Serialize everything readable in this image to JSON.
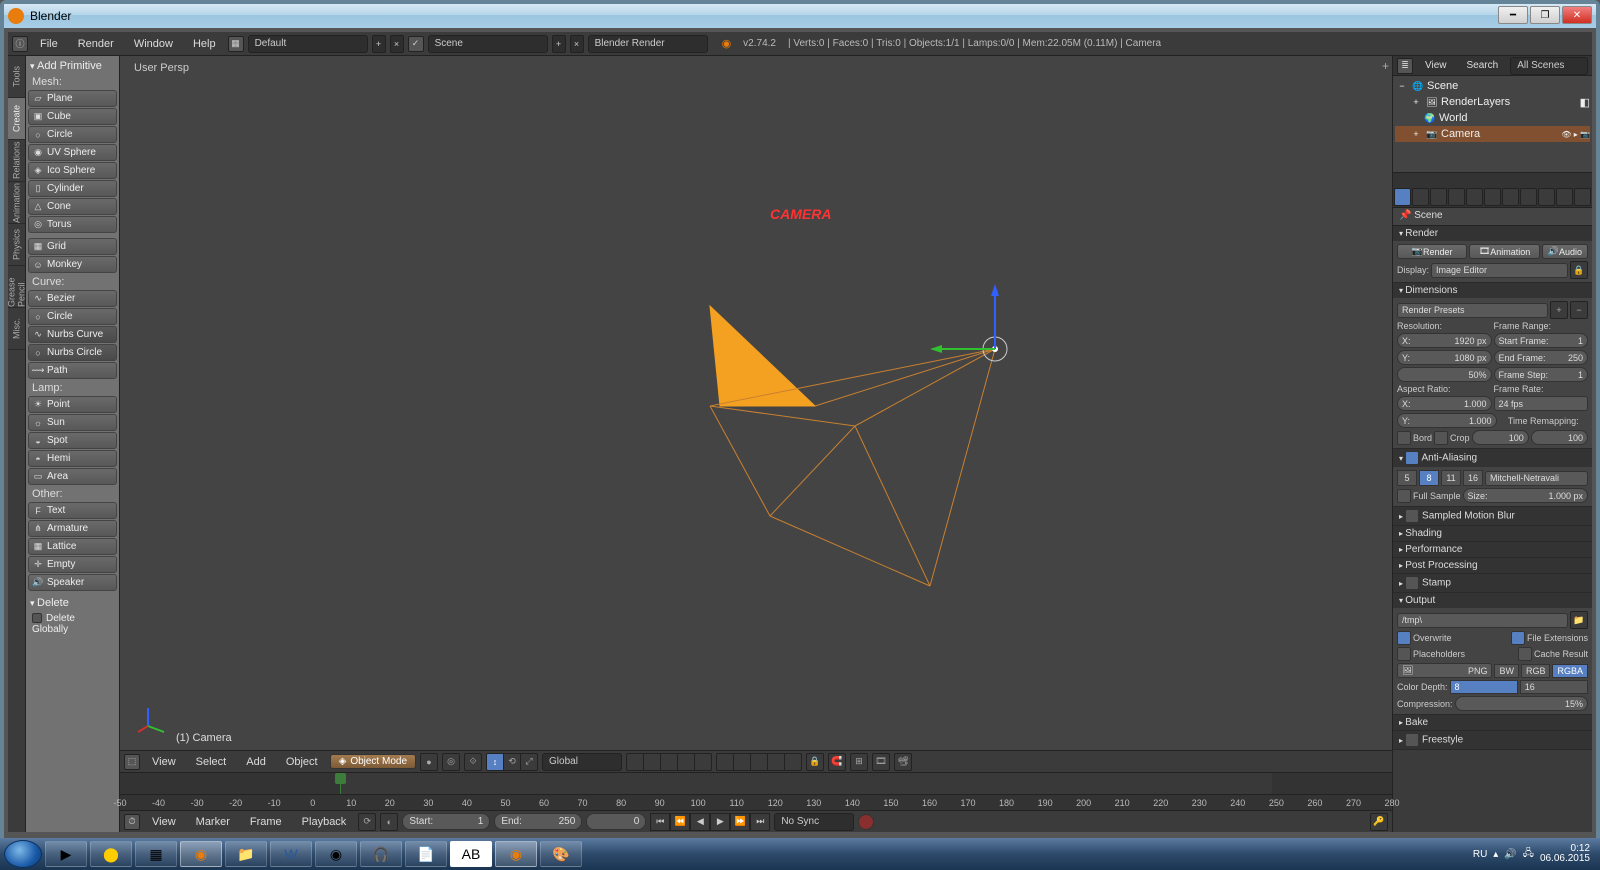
{
  "window": {
    "title": "Blender"
  },
  "info": {
    "menus": [
      "File",
      "Render",
      "Window",
      "Help"
    ],
    "layout": "Default",
    "scene": "Scene",
    "engine": "Blender Render",
    "version": "v2.74.2",
    "stats": "| Verts:0 | Faces:0 | Tris:0 | Objects:1/1 | Lamps:0/0 | Mem:22.05M (0.11M) | Camera"
  },
  "vtabs": [
    "Tools",
    "Create",
    "Relations",
    "Animation",
    "Physics",
    "Grease Pencil",
    "Misc."
  ],
  "tools": {
    "panel": "Add Primitive",
    "groups": [
      {
        "label": "Mesh:",
        "items": [
          "Plane",
          "Cube",
          "Circle",
          "UV Sphere",
          "Ico Sphere",
          "Cylinder",
          "Cone",
          "Torus"
        ]
      },
      {
        "label": "",
        "items": [
          "Grid",
          "Monkey"
        ]
      },
      {
        "label": "Curve:",
        "items": [
          "Bezier",
          "Circle",
          "Nurbs Curve",
          "Nurbs Circle",
          "Path"
        ]
      },
      {
        "label": "Lamp:",
        "items": [
          "Point",
          "Sun",
          "Spot",
          "Hemi",
          "Area"
        ]
      },
      {
        "label": "Other:",
        "items": [
          "Text",
          "Armature",
          "Lattice",
          "Empty",
          "Speaker"
        ]
      }
    ],
    "operator": {
      "title": "Delete",
      "check_label": "Delete Globally"
    }
  },
  "viewport": {
    "persp": "User Persp",
    "overlay": "CAMERA",
    "selected": "(1) Camera",
    "header": {
      "menus": [
        "View",
        "Select",
        "Add",
        "Object"
      ],
      "mode": "Object Mode",
      "orientation": "Global"
    }
  },
  "timeline": {
    "ticks": [
      "-50",
      "-40",
      "-30",
      "-20",
      "-10",
      "0",
      "10",
      "20",
      "30",
      "40",
      "50",
      "60",
      "70",
      "80",
      "90",
      "100",
      "110",
      "120",
      "130",
      "140",
      "150",
      "160",
      "170",
      "180",
      "190",
      "200",
      "210",
      "220",
      "230",
      "240",
      "250",
      "260",
      "270",
      "280"
    ],
    "header": {
      "menus": [
        "View",
        "Marker",
        "Frame",
        "Playback"
      ],
      "start_label": "Start:",
      "start": "1",
      "end_label": "End:",
      "end": "250",
      "current": "0",
      "sync": "No Sync"
    }
  },
  "outliner": {
    "header": [
      "View",
      "Search",
      "All Scenes"
    ],
    "rows": [
      {
        "icon": "🌐",
        "label": "Scene",
        "depth": 0
      },
      {
        "icon": "🖼",
        "label": "RenderLayers",
        "depth": 1
      },
      {
        "icon": "🌍",
        "label": "World",
        "depth": 1
      },
      {
        "icon": "📷",
        "label": "Camera",
        "depth": 1,
        "sel": true
      }
    ]
  },
  "props": {
    "crumb": "Scene",
    "render": {
      "title": "Render",
      "buttons": [
        "Render",
        "Animation",
        "Audio"
      ],
      "display_label": "Display:",
      "display": "Image Editor"
    },
    "dimensions": {
      "title": "Dimensions",
      "presets": "Render Presets",
      "res_label": "Resolution:",
      "framerange_label": "Frame Range:",
      "x": "1920 px",
      "y": "1080 px",
      "pct": "50%",
      "start_l": "Start Frame:",
      "start": "1",
      "end_l": "End Frame:",
      "end": "250",
      "step_l": "Frame Step:",
      "step": "1",
      "aspect_label": "Aspect Ratio:",
      "ax": "1.000",
      "ay": "1.000",
      "rate_label": "Frame Rate:",
      "fps": "24 fps",
      "remap_label": "Time Remapping:",
      "old": "100",
      "new": "100",
      "border": "Bord",
      "crop": "Crop"
    },
    "aa": {
      "title": "Anti-Aliasing",
      "samples": [
        "5",
        "8",
        "11",
        "16"
      ],
      "active": "8",
      "filter": "Mitchell-Netravali",
      "full_l": "Full Sample",
      "size_l": "Size:",
      "size": "1.000 px"
    },
    "blur": {
      "title": "Sampled Motion Blur"
    },
    "shading": {
      "title": "Shading"
    },
    "perf": {
      "title": "Performance"
    },
    "post": {
      "title": "Post Processing"
    },
    "stamp": {
      "title": "Stamp"
    },
    "output": {
      "title": "Output",
      "path": "/tmp\\",
      "overwrite": "Overwrite",
      "placeholders": "Placeholders",
      "ext": "File Extensions",
      "cache": "Cache Result",
      "format": "PNG",
      "depth_label": "Color Depth:",
      "d8": "8",
      "d16": "16",
      "comp_label": "Compression:",
      "comp": "15%",
      "bw": "BW",
      "rgb": "RGB",
      "rgba": "RGBA"
    },
    "bake": {
      "title": "Bake"
    },
    "freestyle": {
      "title": "Freestyle"
    }
  },
  "taskbar": {
    "lang": "RU",
    "time": "0:12",
    "date": "06.06.2015"
  }
}
